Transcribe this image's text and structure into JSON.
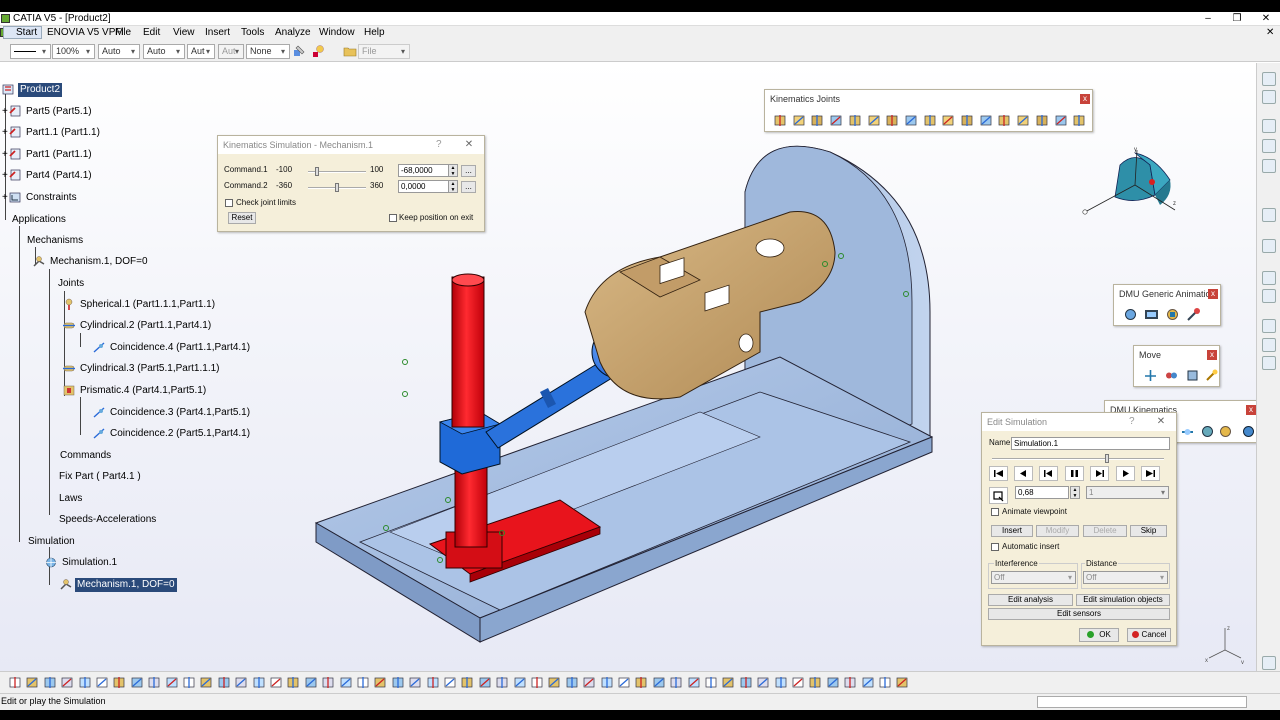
{
  "window": {
    "title": "CATIA V5 - [Product2]",
    "minimize": "–",
    "restore": "❐",
    "close": "✕"
  },
  "menu": {
    "items": [
      "Start",
      "ENOVIA V5 VPM",
      "File",
      "Edit",
      "View",
      "Insert",
      "Tools",
      "Analyze",
      "Window",
      "Help"
    ],
    "doc_close": "✕"
  },
  "toolbar": {
    "zoom": "100%",
    "combo2": "Auto",
    "combo3": "Auto",
    "combo4": "Aut",
    "combo5": "Aut",
    "combo6": "None",
    "file_combo": "File"
  },
  "tree": {
    "root": "Product2",
    "part5": "Part5 (Part5.1)",
    "part11": "Part1.1 (Part1.1)",
    "part1": "Part1 (Part1.1)",
    "part4": "Part4 (Part4.1)",
    "constraints": "Constraints",
    "applications": "Applications",
    "mechanisms": "Mechanisms",
    "mechanism1": "Mechanism.1, DOF=0",
    "joints": "Joints",
    "spherical1": "Spherical.1 (Part1.1.1,Part1.1)",
    "cylindrical2": "Cylindrical.2 (Part1.1,Part4.1)",
    "coincidence4": "Coincidence.4 (Part1.1,Part4.1)",
    "cylindrical3": "Cylindrical.3 (Part5.1,Part1.1.1)",
    "prismatic4": "Prismatic.4 (Part4.1,Part5.1)",
    "coincidence3": "Coincidence.3 (Part4.1,Part5.1)",
    "coincidence2": "Coincidence.2 (Part5.1,Part4.1)",
    "commands": "Commands",
    "fixpart": "Fix Part ( Part4.1 )",
    "laws": "Laws",
    "speeds": "Speeds-Accelerations",
    "simulation": "Simulation",
    "simulation1": "Simulation.1",
    "mechanism1b": "Mechanism.1, DOF=0"
  },
  "kin_sim": {
    "title": "Kinematics Simulation - Mechanism.1",
    "help": "?",
    "close": "✕",
    "cmd1_label": "Command.1",
    "cmd1_min": "-100",
    "cmd1_max": "100",
    "cmd1_value": "-68,0000",
    "cmd1_level": 0.16,
    "cmd2_label": "Command.2",
    "cmd2_min": "-360",
    "cmd2_max": "360",
    "cmd2_value": "0,0000",
    "cmd2_level": 0.5,
    "more": "...",
    "check_limits": "Check joint limits",
    "reset": "Reset",
    "keep_position": "Keep position on exit"
  },
  "kin_joints": {
    "title": "Kinematics Joints",
    "close": "x"
  },
  "dmu_anim": {
    "title": "DMU Generic Animation",
    "close": "x"
  },
  "move": {
    "title": "Move",
    "close": "x"
  },
  "dmu_kin": {
    "title": "DMU Kinematics",
    "close": "x"
  },
  "edit_sim": {
    "title": "Edit Simulation",
    "help": "?",
    "close": "✕",
    "name_label": "Name",
    "name_value": "Simulation.1",
    "slider_level": 0.67,
    "step_value": "0,68",
    "step_count": "1",
    "animate_viewpoint": "Animate viewpoint",
    "insert": "Insert",
    "modify": "Modify",
    "delete": "Delete",
    "skip": "Skip",
    "automatic_insert": "Automatic insert",
    "interference": "Interference",
    "interference_value": "Off",
    "distance": "Distance",
    "distance_value": "Off",
    "edit_analysis": "Edit analysis",
    "edit_sim_objects": "Edit simulation objects",
    "edit_sensors": "Edit sensors",
    "ok": "OK",
    "cancel": "Cancel"
  },
  "status": {
    "text": "Edit or play the Simulation"
  },
  "colors": {
    "accent_blue": "#2f7ddc",
    "red_part": "#e8141c",
    "tan_part": "#c8a56e",
    "base": "#a6c0e2"
  }
}
